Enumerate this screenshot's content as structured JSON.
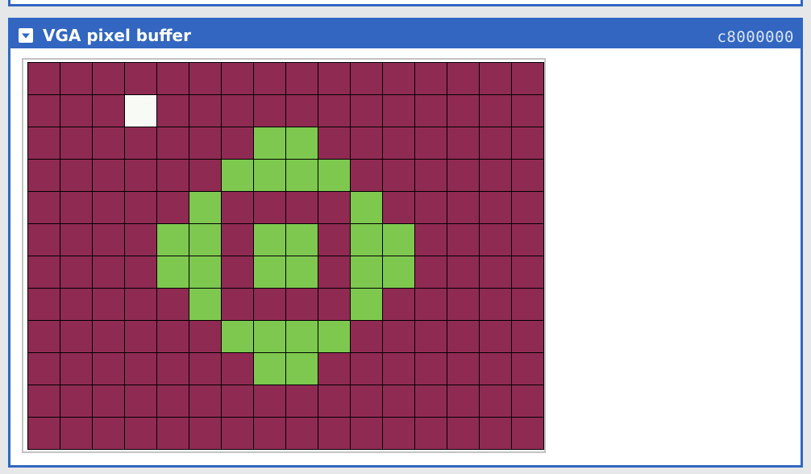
{
  "panel": {
    "title": "VGA pixel buffer",
    "address": "c8000000",
    "collapse_icon": "chevron-down-icon"
  },
  "colors": {
    "accent": "#3266c0",
    "pixel_background": "#8f2a53",
    "pixel_green": "#7ec850",
    "pixel_white": "#f8faf6",
    "grid_lines": "#000000"
  },
  "pixel_buffer": {
    "columns": 16,
    "rows": 12,
    "legend": {
      "0": "pixel_background",
      "1": "pixel_green",
      "2": "pixel_white"
    },
    "pixels": [
      [
        0,
        0,
        0,
        0,
        0,
        0,
        0,
        0,
        0,
        0,
        0,
        0,
        0,
        0,
        0,
        0
      ],
      [
        0,
        0,
        0,
        2,
        0,
        0,
        0,
        0,
        0,
        0,
        0,
        0,
        0,
        0,
        0,
        0
      ],
      [
        0,
        0,
        0,
        0,
        0,
        0,
        0,
        1,
        1,
        0,
        0,
        0,
        0,
        0,
        0,
        0
      ],
      [
        0,
        0,
        0,
        0,
        0,
        0,
        1,
        1,
        1,
        1,
        0,
        0,
        0,
        0,
        0,
        0
      ],
      [
        0,
        0,
        0,
        0,
        0,
        1,
        0,
        0,
        0,
        0,
        1,
        0,
        0,
        0,
        0,
        0
      ],
      [
        0,
        0,
        0,
        0,
        1,
        1,
        0,
        1,
        1,
        0,
        1,
        1,
        0,
        0,
        0,
        0
      ],
      [
        0,
        0,
        0,
        0,
        1,
        1,
        0,
        1,
        1,
        0,
        1,
        1,
        0,
        0,
        0,
        0
      ],
      [
        0,
        0,
        0,
        0,
        0,
        1,
        0,
        0,
        0,
        0,
        1,
        0,
        0,
        0,
        0,
        0
      ],
      [
        0,
        0,
        0,
        0,
        0,
        0,
        1,
        1,
        1,
        1,
        0,
        0,
        0,
        0,
        0,
        0
      ],
      [
        0,
        0,
        0,
        0,
        0,
        0,
        0,
        1,
        1,
        0,
        0,
        0,
        0,
        0,
        0,
        0
      ],
      [
        0,
        0,
        0,
        0,
        0,
        0,
        0,
        0,
        0,
        0,
        0,
        0,
        0,
        0,
        0,
        0
      ],
      [
        0,
        0,
        0,
        0,
        0,
        0,
        0,
        0,
        0,
        0,
        0,
        0,
        0,
        0,
        0,
        0
      ]
    ]
  }
}
